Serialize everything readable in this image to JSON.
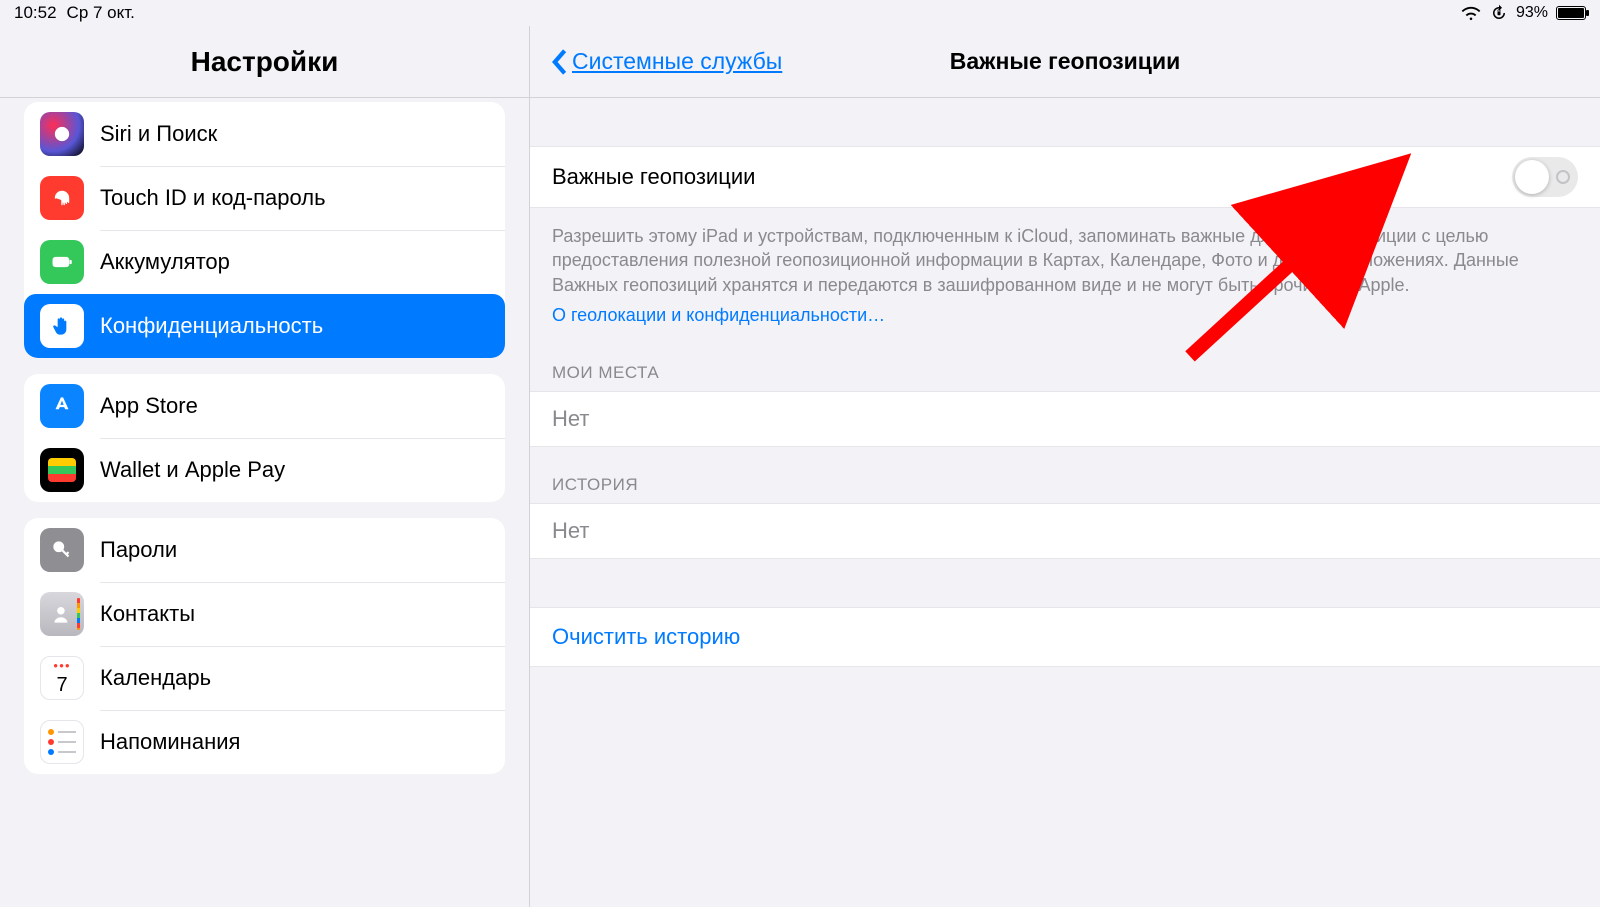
{
  "status": {
    "time": "10:52",
    "date": "Ср 7 окт.",
    "battery_pct": "93%"
  },
  "sidebar": {
    "title": "Настройки",
    "group1": [
      {
        "label": "Siri и Поиск"
      },
      {
        "label": "Touch ID и код-пароль"
      },
      {
        "label": "Аккумулятор"
      },
      {
        "label": "Конфиденциальность",
        "selected": true
      }
    ],
    "group2": [
      {
        "label": "App Store"
      },
      {
        "label": "Wallet и Apple Pay"
      }
    ],
    "group3": [
      {
        "label": "Пароли"
      },
      {
        "label": "Контакты"
      },
      {
        "label": "Календарь"
      },
      {
        "label": "Напоминания"
      }
    ]
  },
  "detail": {
    "back_label": "Системные службы",
    "title": "Важные геопозиции",
    "toggle_label": "Важные геопозиции",
    "toggle_on": false,
    "footer_text": "Разрешить этому iPad и устройствам, подключенным к iCloud, запоминать важные для Вас геопозиции с целью предоставления полезной геопозиционной информации в Картах, Календаре, Фото и других приложениях. Данные Важных геопозиций хранятся и передаются в зашифрованном виде и не могут быть прочитаны Apple.",
    "footer_link": "О геолокации и конфиденциальности…",
    "section_places_header": "МОИ МЕСТА",
    "section_places_value": "Нет",
    "section_history_header": "ИСТОРИЯ",
    "section_history_value": "Нет",
    "clear_history": "Очистить историю"
  },
  "calendar_icon_num": "7"
}
